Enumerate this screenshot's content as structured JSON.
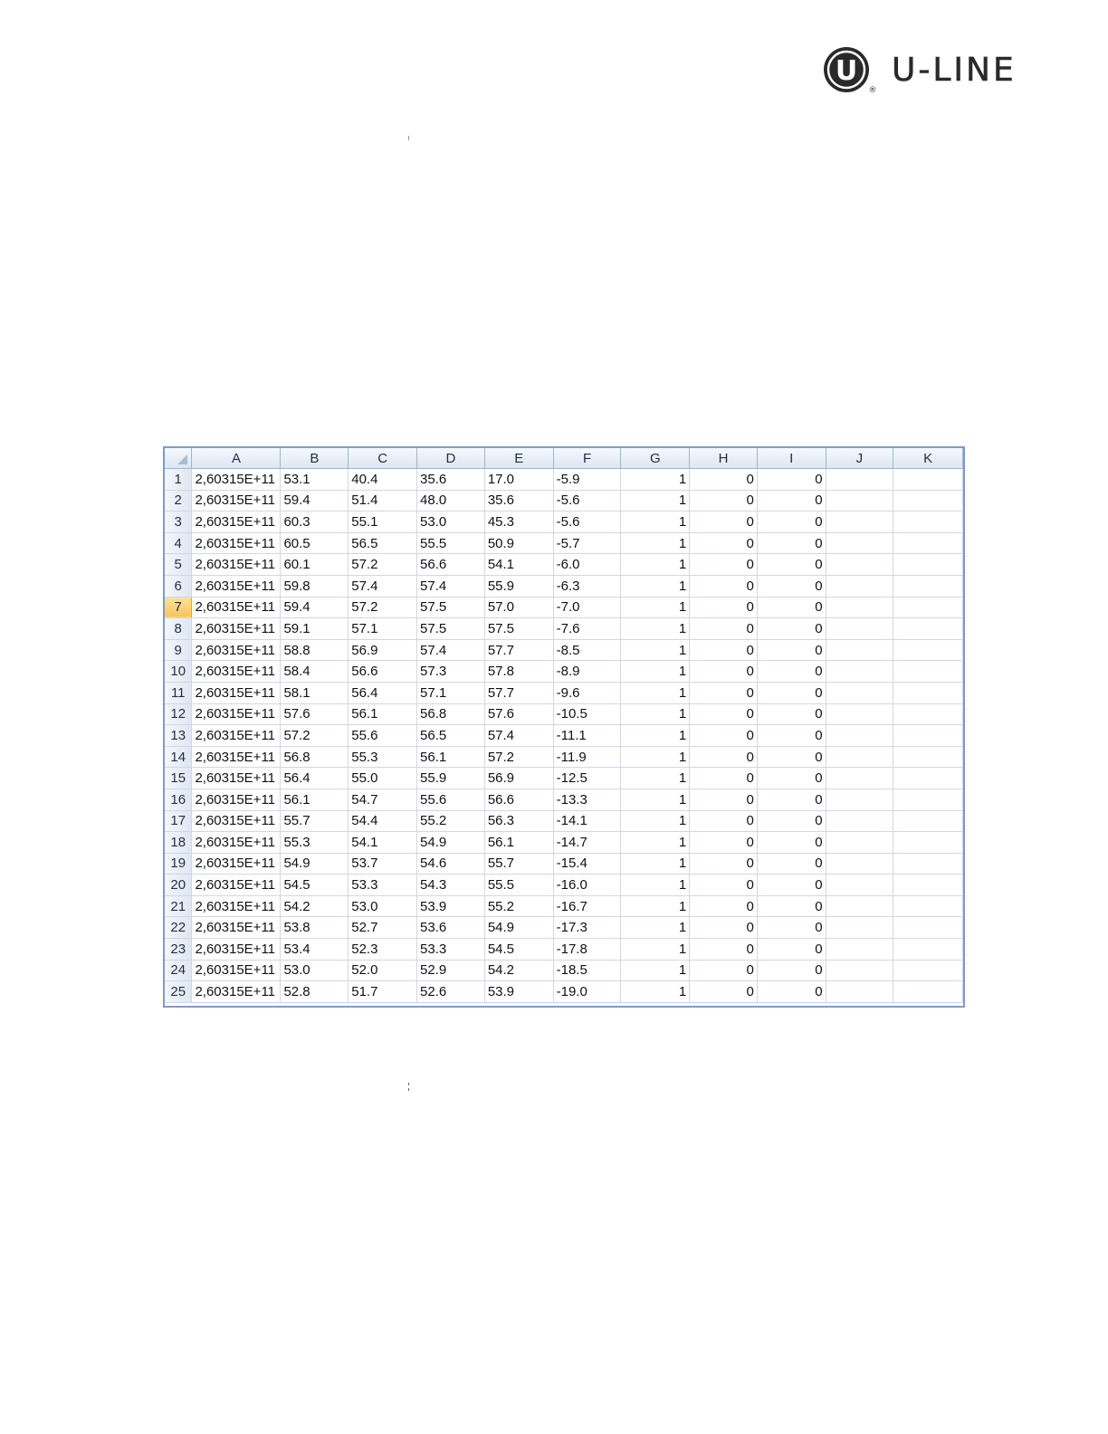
{
  "logo": {
    "text": "U-LINE",
    "letter": "U",
    "registered": "®",
    "color": "#2a2a2a"
  },
  "sheet": {
    "columns": [
      "A",
      "B",
      "C",
      "D",
      "E",
      "F",
      "G",
      "H",
      "I",
      "J",
      "K"
    ],
    "active_row": 7,
    "accent": "#7b9cc9",
    "rows": [
      {
        "n": "1",
        "a": "2,60315E+11",
        "b": "53.1",
        "c": "40.4",
        "d": "35.6",
        "e": "17.0",
        "f": "-5.9",
        "g": "1",
        "h": "0",
        "i": "0"
      },
      {
        "n": "2",
        "a": "2,60315E+11",
        "b": "59.4",
        "c": "51.4",
        "d": "48.0",
        "e": "35.6",
        "f": "-5.6",
        "g": "1",
        "h": "0",
        "i": "0"
      },
      {
        "n": "3",
        "a": "2,60315E+11",
        "b": "60.3",
        "c": "55.1",
        "d": "53.0",
        "e": "45.3",
        "f": "-5.6",
        "g": "1",
        "h": "0",
        "i": "0"
      },
      {
        "n": "4",
        "a": "2,60315E+11",
        "b": "60.5",
        "c": "56.5",
        "d": "55.5",
        "e": "50.9",
        "f": "-5.7",
        "g": "1",
        "h": "0",
        "i": "0"
      },
      {
        "n": "5",
        "a": "2,60315E+11",
        "b": "60.1",
        "c": "57.2",
        "d": "56.6",
        "e": "54.1",
        "f": "-6.0",
        "g": "1",
        "h": "0",
        "i": "0"
      },
      {
        "n": "6",
        "a": "2,60315E+11",
        "b": "59.8",
        "c": "57.4",
        "d": "57.4",
        "e": "55.9",
        "f": "-6.3",
        "g": "1",
        "h": "0",
        "i": "0"
      },
      {
        "n": "7",
        "a": "2,60315E+11",
        "b": "59.4",
        "c": "57.2",
        "d": "57.5",
        "e": "57.0",
        "f": "-7.0",
        "g": "1",
        "h": "0",
        "i": "0"
      },
      {
        "n": "8",
        "a": "2,60315E+11",
        "b": "59.1",
        "c": "57.1",
        "d": "57.5",
        "e": "57.5",
        "f": "-7.6",
        "g": "1",
        "h": "0",
        "i": "0"
      },
      {
        "n": "9",
        "a": "2,60315E+11",
        "b": "58.8",
        "c": "56.9",
        "d": "57.4",
        "e": "57.7",
        "f": "-8.5",
        "g": "1",
        "h": "0",
        "i": "0"
      },
      {
        "n": "10",
        "a": "2,60315E+11",
        "b": "58.4",
        "c": "56.6",
        "d": "57.3",
        "e": "57.8",
        "f": "-8.9",
        "g": "1",
        "h": "0",
        "i": "0"
      },
      {
        "n": "11",
        "a": "2,60315E+11",
        "b": "58.1",
        "c": "56.4",
        "d": "57.1",
        "e": "57.7",
        "f": "-9.6",
        "g": "1",
        "h": "0",
        "i": "0"
      },
      {
        "n": "12",
        "a": "2,60315E+11",
        "b": "57.6",
        "c": "56.1",
        "d": "56.8",
        "e": "57.6",
        "f": "-10.5",
        "g": "1",
        "h": "0",
        "i": "0"
      },
      {
        "n": "13",
        "a": "2,60315E+11",
        "b": "57.2",
        "c": "55.6",
        "d": "56.5",
        "e": "57.4",
        "f": "-11.1",
        "g": "1",
        "h": "0",
        "i": "0"
      },
      {
        "n": "14",
        "a": "2,60315E+11",
        "b": "56.8",
        "c": "55.3",
        "d": "56.1",
        "e": "57.2",
        "f": "-11.9",
        "g": "1",
        "h": "0",
        "i": "0"
      },
      {
        "n": "15",
        "a": "2,60315E+11",
        "b": "56.4",
        "c": "55.0",
        "d": "55.9",
        "e": "56.9",
        "f": "-12.5",
        "g": "1",
        "h": "0",
        "i": "0"
      },
      {
        "n": "16",
        "a": "2,60315E+11",
        "b": "56.1",
        "c": "54.7",
        "d": "55.6",
        "e": "56.6",
        "f": "-13.3",
        "g": "1",
        "h": "0",
        "i": "0"
      },
      {
        "n": "17",
        "a": "2,60315E+11",
        "b": "55.7",
        "c": "54.4",
        "d": "55.2",
        "e": "56.3",
        "f": "-14.1",
        "g": "1",
        "h": "0",
        "i": "0"
      },
      {
        "n": "18",
        "a": "2,60315E+11",
        "b": "55.3",
        "c": "54.1",
        "d": "54.9",
        "e": "56.1",
        "f": "-14.7",
        "g": "1",
        "h": "0",
        "i": "0"
      },
      {
        "n": "19",
        "a": "2,60315E+11",
        "b": "54.9",
        "c": "53.7",
        "d": "54.6",
        "e": "55.7",
        "f": "-15.4",
        "g": "1",
        "h": "0",
        "i": "0"
      },
      {
        "n": "20",
        "a": "2,60315E+11",
        "b": "54.5",
        "c": "53.3",
        "d": "54.3",
        "e": "55.5",
        "f": "-16.0",
        "g": "1",
        "h": "0",
        "i": "0"
      },
      {
        "n": "21",
        "a": "2,60315E+11",
        "b": "54.2",
        "c": "53.0",
        "d": "53.9",
        "e": "55.2",
        "f": "-16.7",
        "g": "1",
        "h": "0",
        "i": "0"
      },
      {
        "n": "22",
        "a": "2,60315E+11",
        "b": "53.8",
        "c": "52.7",
        "d": "53.6",
        "e": "54.9",
        "f": "-17.3",
        "g": "1",
        "h": "0",
        "i": "0"
      },
      {
        "n": "23",
        "a": "2,60315E+11",
        "b": "53.4",
        "c": "52.3",
        "d": "53.3",
        "e": "54.5",
        "f": "-17.8",
        "g": "1",
        "h": "0",
        "i": "0"
      },
      {
        "n": "24",
        "a": "2,60315E+11",
        "b": "53.0",
        "c": "52.0",
        "d": "52.9",
        "e": "54.2",
        "f": "-18.5",
        "g": "1",
        "h": "0",
        "i": "0"
      },
      {
        "n": "25",
        "a": "2,60315E+11",
        "b": "52.8",
        "c": "51.7",
        "d": "52.6",
        "e": "53.9",
        "f": "-19.0",
        "g": "1",
        "h": "0",
        "i": "0"
      }
    ]
  }
}
